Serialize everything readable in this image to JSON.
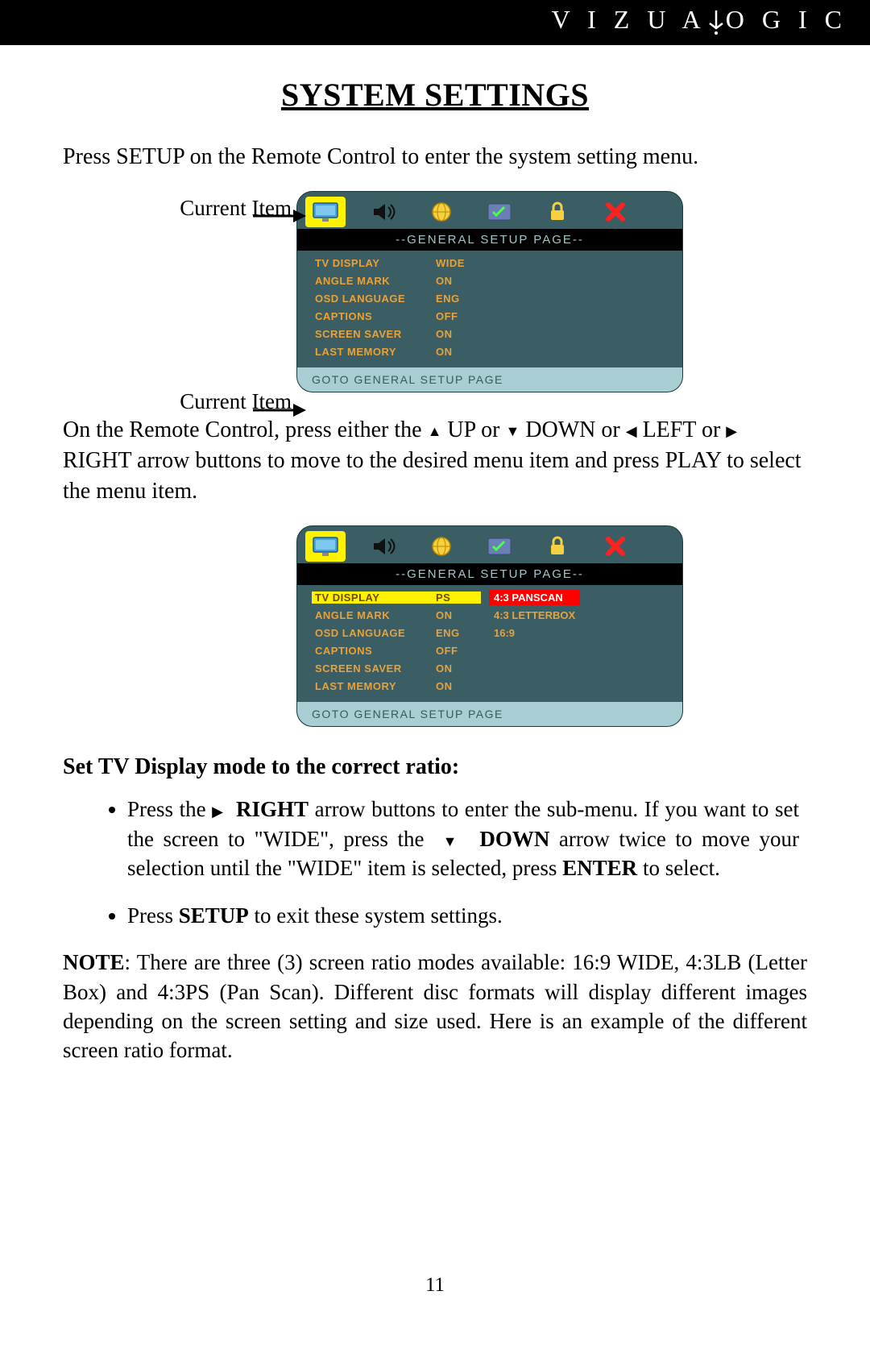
{
  "brand": "VIZUALOGIC",
  "title": "SYSTEM SETTINGS",
  "intro": "Press SETUP on the Remote Control to enter the system setting menu.",
  "labels": {
    "current_item_top": "Current Item",
    "current_item_bottom": "Current Item"
  },
  "osd1": {
    "title": "--GENERAL SETUP PAGE--",
    "rows": [
      {
        "label": "TV DISPLAY",
        "value": "WIDE"
      },
      {
        "label": "ANGLE MARK",
        "value": "ON"
      },
      {
        "label": "OSD LANGUAGE",
        "value": "ENG"
      },
      {
        "label": "CAPTIONS",
        "value": "OFF"
      },
      {
        "label": "SCREEN SAVER",
        "value": "ON"
      },
      {
        "label": "LAST MEMORY",
        "value": "ON"
      }
    ],
    "footer": "GOTO GENERAL SETUP PAGE"
  },
  "nav_text": {
    "p1a": "On the Remote Control, press either the ",
    "up": " UP or ",
    "down": " DOWN or ",
    "left": " LEFT or ",
    "p1b": " RIGHT arrow buttons to move to the desired menu item and press PLAY to select the menu item."
  },
  "osd2": {
    "title": "--GENERAL SETUP PAGE--",
    "rows": [
      {
        "label": "TV DISPLAY",
        "value": "PS",
        "hl": true
      },
      {
        "label": "ANGLE MARK",
        "value": "ON"
      },
      {
        "label": "OSD LANGUAGE",
        "value": "ENG"
      },
      {
        "label": "CAPTIONS",
        "value": "OFF"
      },
      {
        "label": "SCREEN SAVER",
        "value": "ON"
      },
      {
        "label": "LAST MEMORY",
        "value": "ON"
      }
    ],
    "submenu": [
      "4:3 PANSCAN",
      "4:3 LETTERBOX",
      "16:9"
    ],
    "footer": "GOTO GENERAL SETUP PAGE"
  },
  "sub_heading": "Set TV Display mode to the correct ratio:",
  "bullets": {
    "b1a": "Press the  ",
    "b1_right": "RIGHT",
    "b1b": " arrow buttons to enter the sub-menu.  If you want to set the screen to \"WIDE\", press the ",
    "b1_down": " DOWN",
    "b1c": " arrow twice to move your selection until the \"WIDE\" item is selected, press ",
    "b1_enter": "ENTER",
    "b1d": " to select.",
    "b2a": "Press ",
    "b2_setup": "SETUP",
    "b2b": " to exit these system settings."
  },
  "note": {
    "label": "NOTE",
    "text": ": There are three (3) screen ratio modes available: 16:9 WIDE, 4:3LB (Letter Box) and 4:3PS (Pan Scan).  Different disc formats will display different images depending on the screen setting and size used.  Here is an example of the different screen ratio format."
  },
  "page_number": "11",
  "icons": [
    "monitor-icon",
    "speaker-icon",
    "globe-icon",
    "checklist-icon",
    "lock-icon",
    "close-icon"
  ]
}
